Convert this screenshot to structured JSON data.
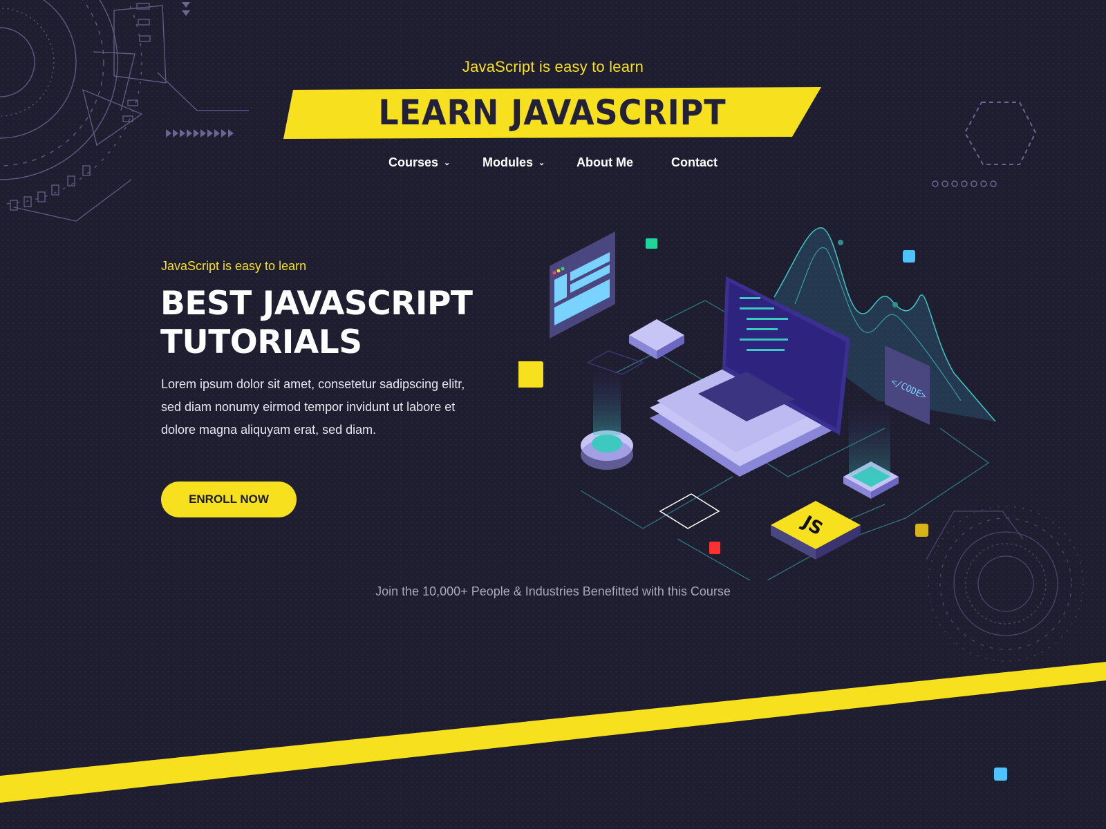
{
  "header": {
    "tagline": "JavaScript is easy to learn",
    "brand_title": "LEARN JAVASCRIPT"
  },
  "nav": {
    "items": [
      {
        "label": "Courses",
        "has_dropdown": true,
        "chevron": "⌄"
      },
      {
        "label": "Modules",
        "has_dropdown": true,
        "chevron": "⌄"
      },
      {
        "label": "About Me",
        "has_dropdown": false
      },
      {
        "label": "Contact",
        "has_dropdown": false
      }
    ]
  },
  "hero": {
    "tagline": "JavaScript is easy to learn",
    "title_line1": "BEST JAVASCRIPT",
    "title_line2": "TUTORIALS",
    "body": "Lorem ipsum dolor sit amet, consetetur sadipscing elitr, sed diam nonumy eirmod tempor invidunt ut labore et dolore magna aliquyam erat, sed diam.",
    "cta_label": "ENROLL NOW"
  },
  "illustration": {
    "code_panel_text": "</CODE>",
    "js_badge_text": "JS"
  },
  "footer_note": "Join the 10,000+ People & Industries Benefitted with this Course",
  "colors": {
    "background": "#1f1d30",
    "accent_yellow": "#f7e11e",
    "accent_teal": "#3ec9c0",
    "accent_lavender": "#c7c5f5",
    "accent_purple": "#3b2f8f"
  }
}
